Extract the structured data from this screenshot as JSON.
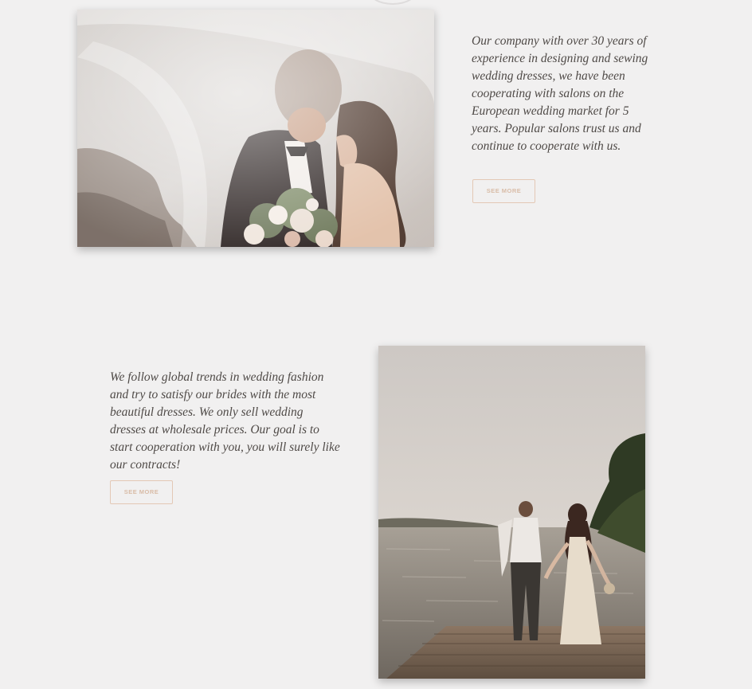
{
  "sections": [
    {
      "text": "Our company with over 30 years of experience in designing and sewing wedding dresses, we have been cooperating with salons on the European wedding market for 5 years. Popular salons trust us and continue to cooperate with us.",
      "button_label": "SEE MORE"
    },
    {
      "text": "We follow global trends in wedding fashion and try to satisfy our brides with the most beautiful dresses. We only sell wedding dresses at wholesale prices. Our goal is to start cooperation with you, you will surely like our contracts!",
      "button_label": "SEE MORE"
    }
  ],
  "colors": {
    "background": "#f1f0f0",
    "body_text": "#4f4a47",
    "button_border": "#e3c8b5",
    "button_text": "#d9bca7"
  }
}
